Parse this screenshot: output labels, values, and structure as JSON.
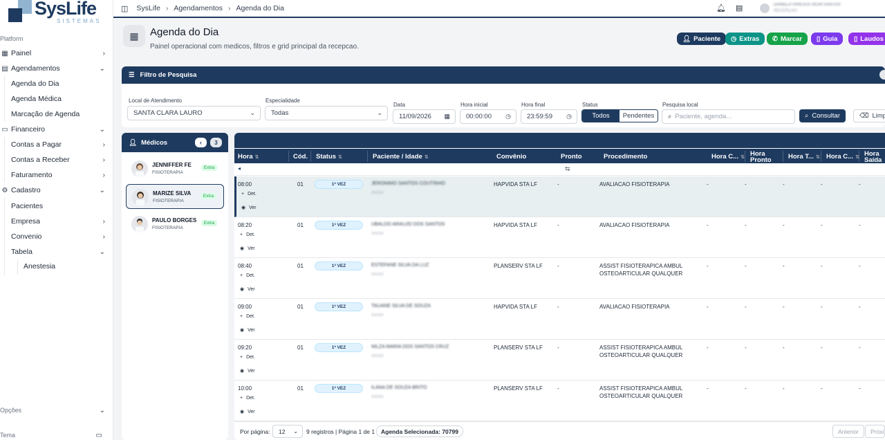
{
  "brand": {
    "name": "SysLife",
    "sub": "SISTEMAS"
  },
  "sidebar": {
    "section_label": "Platform",
    "items": [
      {
        "label": "Painel"
      },
      {
        "label": "Agendamentos"
      },
      {
        "label": "Agenda do Dia"
      },
      {
        "label": "Agenda Médica"
      },
      {
        "label": "Marcação de Agenda"
      },
      {
        "label": "Financeiro"
      },
      {
        "label": "Contas a Pagar"
      },
      {
        "label": "Contas a Receber"
      },
      {
        "label": "Faturamento"
      },
      {
        "label": "Cadastro"
      },
      {
        "label": "Pacientes"
      },
      {
        "label": "Empresa"
      },
      {
        "label": "Convenio"
      },
      {
        "label": "Tabela"
      },
      {
        "label": "Anestesia"
      }
    ],
    "options_label": "Opções",
    "theme_label": "Tema"
  },
  "topbar": {
    "breadcrumb": [
      "SysLife",
      "Agendamentos",
      "Agenda do Dia"
    ],
    "user_name": "DANIELA VINICIUS SILVA SANTOS",
    "user_role": "RECEPÇÃO"
  },
  "page": {
    "title": "Agenda do Dia",
    "subtitle": "Painel operacional com medicos, filtros e grid principal da recepcao."
  },
  "actions": [
    {
      "label": "Paciente",
      "color": "#1e3a5f"
    },
    {
      "label": "Extras",
      "color": "#0d9488"
    },
    {
      "label": "Marcar",
      "color": "#16a34a"
    },
    {
      "label": "Guia",
      "color": "#7c3aed"
    },
    {
      "label": "Laudos",
      "color": "#9333ea"
    }
  ],
  "filter": {
    "heading": "Filtro de Pesquisa",
    "local_label": "Local de Atendimento",
    "local_value": "SANTA CLARA LAURO",
    "esp_label": "Especialidade",
    "esp_value": "Todas",
    "data_label": "Data",
    "data_value": "11/09/2026",
    "hora_ini_label": "Hora inicial",
    "hora_ini_value": "00:00:00",
    "hora_fim_label": "Hora final",
    "hora_fim_value": "23:59:59",
    "status_label": "Status",
    "status_opts": [
      "Todos",
      "Pendentes"
    ],
    "pesquisa_label": "Pesquisa local",
    "pesquisa_placeholder": "Paciente, agenda...",
    "consultar": "Consultar",
    "limpar": "Limpar"
  },
  "medicos": {
    "heading": "Médicos",
    "count": "3",
    "list": [
      {
        "name": "JENNIFFER FE",
        "spec": "FISIOTERAPIA",
        "badge": "Extra"
      },
      {
        "name": "MARIZE SILVA",
        "spec": "FISIOTERAPIA",
        "badge": "Extra"
      },
      {
        "name": "PAULO BORGES",
        "spec": "FISIOTERAPIA",
        "badge": "Extra"
      }
    ]
  },
  "grid": {
    "columns": [
      "Hora",
      "Cód.",
      "Status",
      "Paciente / Idade",
      "Convênio",
      "Pronto",
      "Procedimento",
      "Hora C...",
      "Hora Pronto",
      "Hora T...",
      "Hora C...",
      "Hora Saída"
    ],
    "act_det": "Det.",
    "act_ver": "Ver",
    "rows": [
      {
        "hora": "08:00",
        "cod": "01",
        "status": "1ª VEZ",
        "paciente": "JERONIMO SANTOS COUTINHO",
        "idade": "XX/XX",
        "convenio": "HAPVIDA STA LF",
        "pronto": "-",
        "proc1": "AVALIACAO FISIOTERAPIA",
        "proc2": "",
        "dash": "-"
      },
      {
        "hora": "08:20",
        "cod": "01",
        "status": "1ª VEZ",
        "paciente": "UBALDO ARAUJO DOS SANTOS",
        "idade": "XX/XX",
        "convenio": "HAPVIDA STA LF",
        "pronto": "-",
        "proc1": "AVALIACAO FISIOTERAPIA",
        "proc2": "",
        "dash": "-"
      },
      {
        "hora": "08:40",
        "cod": "01",
        "status": "1ª VEZ",
        "paciente": "ESTEFANE SILVA DA LUZ",
        "idade": "XX/XX",
        "convenio": "PLANSERV STA LF",
        "pronto": "-",
        "proc1": "ASSIST FISIOTERAPICA AMBUL",
        "proc2": "OSTEOARTICULAR QUALQUER",
        "dash": "-"
      },
      {
        "hora": "09:00",
        "cod": "01",
        "status": "1ª VEZ",
        "paciente": "TAUANE SILVA DE SOUZA",
        "idade": "XX/XX",
        "convenio": "HAPVIDA STA LF",
        "pronto": "-",
        "proc1": "AVALIACAO FISIOTERAPIA",
        "proc2": "",
        "dash": "-"
      },
      {
        "hora": "09:20",
        "cod": "01",
        "status": "1ª VEZ",
        "paciente": "NILZA MARIA DOS SANTOS CRUZ",
        "idade": "XX/XX",
        "convenio": "PLANSERV STA LF",
        "pronto": "-",
        "proc1": "ASSIST FISIOTERAPICA AMBUL",
        "proc2": "OSTEOARTICULAR QUALQUER",
        "dash": "-"
      },
      {
        "hora": "10:00",
        "cod": "01",
        "status": "1ª VEZ",
        "paciente": "ILANA DE SOUZA BRITO",
        "idade": "XX/XX",
        "convenio": "PLANSERV STA LF",
        "pronto": "-",
        "proc1": "ASSIST FISIOTERAPICA AMBUL",
        "proc2": "OSTEOARTICULAR QUALQUER",
        "dash": "-"
      }
    ],
    "footer": {
      "por_pagina_label": "Por página:",
      "por_pagina_value": "12",
      "info": "9 registros | Página 1 de 1",
      "agenda_sel": "Agenda Selecionada: 70799",
      "anterior": "Anterior",
      "proxima": "Próxima"
    }
  }
}
